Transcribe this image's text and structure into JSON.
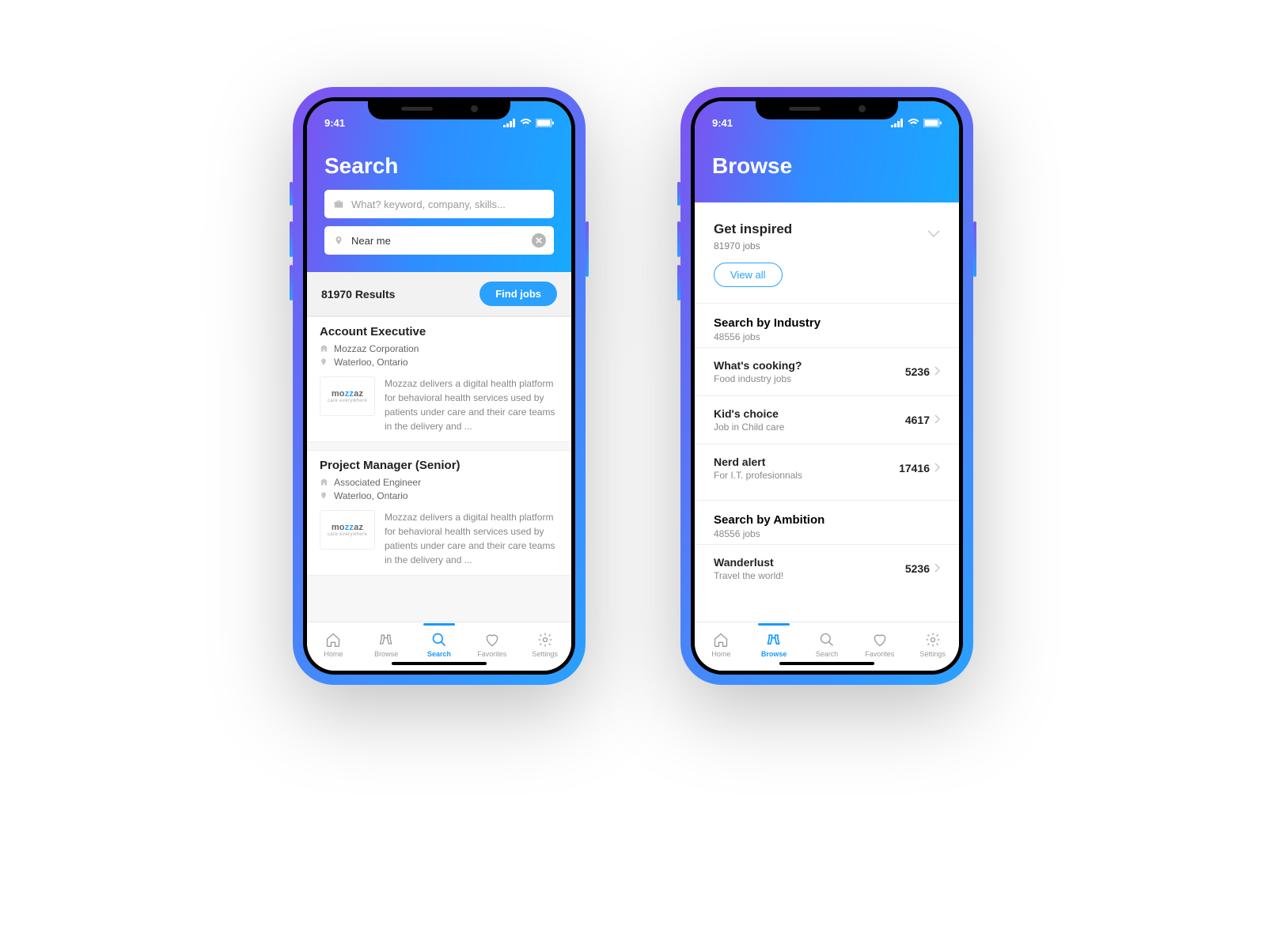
{
  "status": {
    "time": "9:41"
  },
  "tabs": {
    "home": "Home",
    "browse": "Browse",
    "search": "Search",
    "favorites": "Favorites",
    "settings": "Settings"
  },
  "search_screen": {
    "title": "Search",
    "keyword_placeholder": "What? keyword, company, skills...",
    "location_value": "Near me",
    "results_count": "81970 Results",
    "find_button": "Find jobs",
    "jobs": [
      {
        "title": "Account Executive",
        "company": "Mozzaz Corporation",
        "location": "Waterloo, Ontario",
        "logo_main": "mozzaz",
        "logo_tag": "care everywhere",
        "description": "Mozzaz delivers a digital health platform for behavioral health services used by patients under care and their care teams in the delivery and ..."
      },
      {
        "title": "Project Manager (Senior)",
        "company": "Associated Engineer",
        "location": "Waterloo, Ontario",
        "logo_main": "mozzaz",
        "logo_tag": "care everywhere",
        "description": "Mozzaz delivers a digital health platform for behavioral health services used by patients under care and their care teams in the delivery and ..."
      }
    ]
  },
  "browse_screen": {
    "title": "Browse",
    "inspired": {
      "title": "Get inspired",
      "sub": "81970 jobs",
      "view_all": "View all"
    },
    "industry_header": {
      "title": "Search by Industry",
      "sub": "48556 jobs"
    },
    "industry_rows": [
      {
        "title": "What's cooking?",
        "sub": "Food industry jobs",
        "count": "5236"
      },
      {
        "title": "Kid's choice",
        "sub": "Job in Child care",
        "count": "4617"
      },
      {
        "title": "Nerd alert",
        "sub": "For I.T. profesionnals",
        "count": "17416"
      }
    ],
    "ambition_header": {
      "title": "Search by Ambition",
      "sub": "48556 jobs"
    },
    "ambition_rows": [
      {
        "title": "Wanderlust",
        "sub": "Travel the world!",
        "count": "5236"
      }
    ]
  }
}
